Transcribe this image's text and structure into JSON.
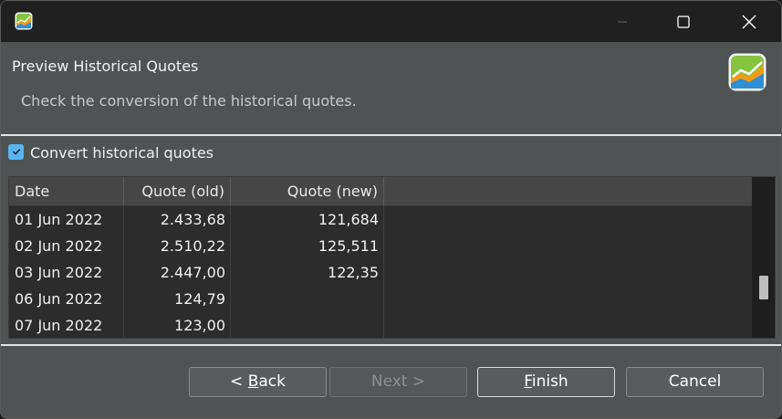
{
  "header": {
    "title": "Preview Historical Quotes",
    "description": "Check the conversion of the historical quotes."
  },
  "option": {
    "label": "Convert historical quotes",
    "checked": true
  },
  "table": {
    "columns": [
      "Date",
      "Quote (old)",
      "Quote (new)"
    ],
    "rows": [
      {
        "date": "01 Jun 2022",
        "old": "2.433,68",
        "new": "121,684"
      },
      {
        "date": "02 Jun 2022",
        "old": "2.510,22",
        "new": "125,511"
      },
      {
        "date": "03 Jun 2022",
        "old": "2.447,00",
        "new": "122,35"
      },
      {
        "date": "06 Jun 2022",
        "old": "124,79",
        "new": ""
      },
      {
        "date": "07 Jun 2022",
        "old": "123,00",
        "new": ""
      }
    ]
  },
  "buttons": {
    "back": {
      "prefix": "< ",
      "mnemonic": "B",
      "rest": "ack"
    },
    "next": "Next >",
    "finish": {
      "mnemonic": "F",
      "rest": "inish"
    },
    "cancel": "Cancel"
  },
  "icons": {
    "app": "app-chart-icon",
    "minimize": "minimize-icon",
    "maximize": "maximize-icon",
    "close": "close-icon",
    "check": "check-icon"
  },
  "colors": {
    "accent": "#57b4ee",
    "dialog_bg": "#505354",
    "titlebar_bg": "#202020",
    "table_bg": "#2c2c2c"
  }
}
